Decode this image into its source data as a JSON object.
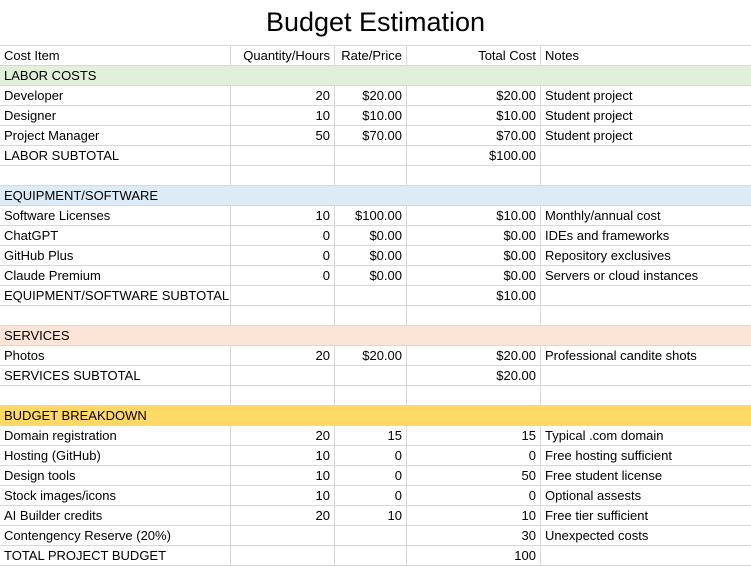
{
  "title": "Budget Estimation",
  "headers": [
    "Cost Item",
    "Quantity/Hours",
    "Rate/Price",
    "Total Cost",
    "Notes"
  ],
  "sections": {
    "labor": {
      "label": "LABOR COSTS",
      "color": "#e2efda",
      "rows": [
        [
          "Developer",
          "20",
          "$20.00",
          "$20.00",
          "Student project"
        ],
        [
          "Designer",
          "10",
          "$10.00",
          "$10.00",
          "Student project"
        ],
        [
          "Project Manager",
          "50",
          "$70.00",
          "$70.00",
          "Student project"
        ]
      ],
      "subtotal": [
        "LABOR SUBTOTAL",
        "",
        "",
        "$100.00",
        ""
      ]
    },
    "equipment": {
      "label": "EQUIPMENT/SOFTWARE",
      "color": "#ddebf7",
      "rows": [
        [
          "Software Licenses",
          "10",
          "$100.00",
          "$10.00",
          "Monthly/annual cost"
        ],
        [
          "ChatGPT",
          "0",
          "$0.00",
          "$0.00",
          "IDEs and frameworks"
        ],
        [
          "GitHub Plus",
          "0",
          "$0.00",
          "$0.00",
          "Repository exclusives"
        ],
        [
          "Claude Premium",
          "0",
          "$0.00",
          "$0.00",
          "Servers or cloud instances"
        ]
      ],
      "subtotal": [
        "EQUIPMENT/SOFTWARE SUBTOTAL",
        "",
        "",
        "$10.00",
        ""
      ]
    },
    "services": {
      "label": "SERVICES",
      "color": "#fce4d6",
      "rows": [
        [
          "Photos",
          "20",
          "$20.00",
          "$20.00",
          "Professional candite shots"
        ]
      ],
      "subtotal": [
        "SERVICES SUBTOTAL",
        "",
        "",
        "$20.00",
        ""
      ]
    },
    "budget": {
      "label": "BUDGET BREAKDOWN",
      "color": "#ffd966",
      "rows": [
        [
          "Domain registration",
          "20",
          "15",
          "15",
          "Typical .com domain"
        ],
        [
          "Hosting (GitHub)",
          "10",
          "0",
          "0",
          "Free hosting sufficient"
        ],
        [
          "Design tools",
          "10",
          "0",
          "50",
          "Free student license"
        ],
        [
          "Stock images/icons",
          "10",
          "0",
          "0",
          "Optional assests"
        ],
        [
          "AI Builder credits",
          "20",
          "10",
          "10",
          "Free tier sufficient"
        ],
        [
          "Contengency Reserve (20%)",
          "",
          "",
          "30",
          "Unexpected costs"
        ],
        [
          "TOTAL PROJECT BUDGET",
          "",
          "",
          "100",
          ""
        ]
      ]
    }
  }
}
